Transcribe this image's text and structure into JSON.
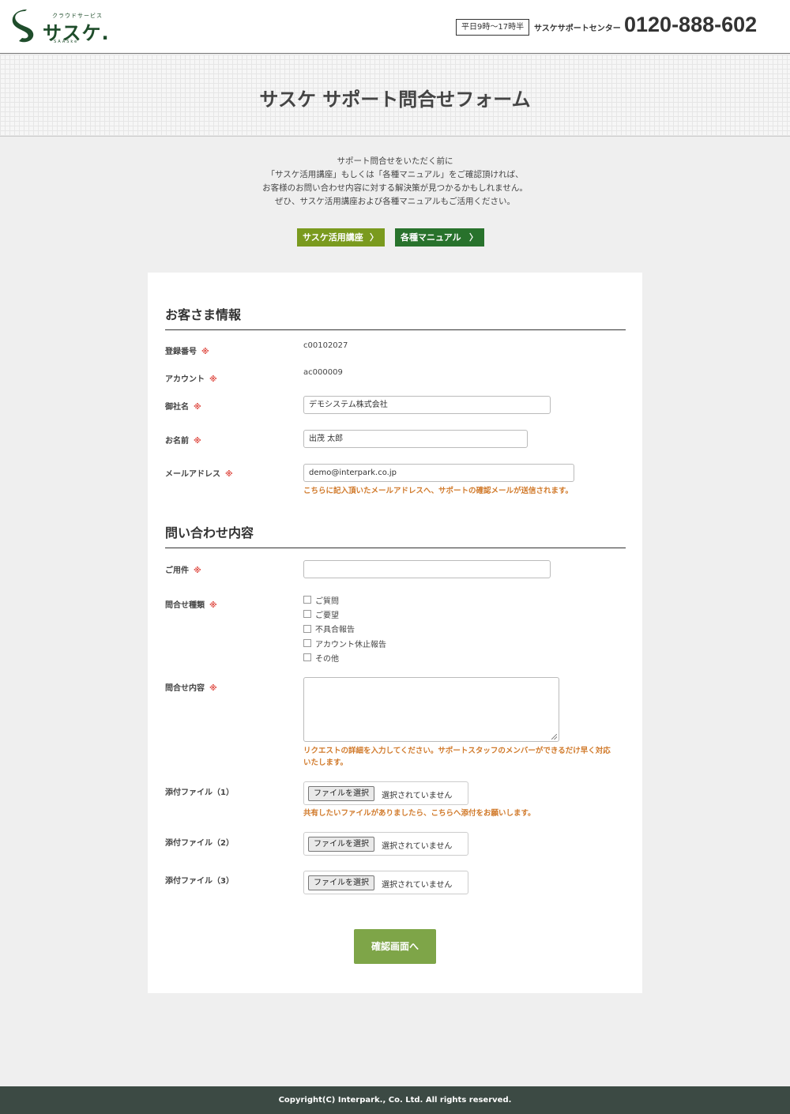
{
  "header": {
    "logo_small": "クラウドサービス",
    "logo_main": "サスケ.",
    "logo_sub": "SAASke",
    "hours": "平日9時〜17時半",
    "center": "サスケサポートセンター",
    "phone": "0120-888-602"
  },
  "banner": {
    "title": "サスケ サポート問合せフォーム"
  },
  "intro": {
    "lines": [
      "サポート問合せをいただく前に",
      "「サスケ活用講座」もしくは「各種マニュアル」をご確認頂ければ、",
      "お客様のお問い合わせ内容に対する解決策が見つかるかもしれません。",
      "ぜひ、サスケ活用講座および各種マニュアルもご活用ください。"
    ],
    "btn_course": "サスケ活用講座",
    "btn_manual": "各種マニュアル",
    "arrow": "〉"
  },
  "customer": {
    "title": "お客さま情報",
    "reg_label": "登録番号",
    "reg_value": "c00102027",
    "account_label": "アカウント",
    "account_value": "ac000009",
    "company_label": "御社名",
    "company_value": "デモシステム株式会社",
    "name_label": "お名前",
    "name_value": "出茂 太郎",
    "email_label": "メールアドレス",
    "email_value": "demo@interpark.co.jp",
    "email_note": "こちらに記入頂いたメールアドレスへ、サポートの確認メールが送信されます。"
  },
  "inquiry": {
    "title": "問い合わせ内容",
    "subject_label": "ご用件",
    "subject_value": "",
    "type_label": "問合せ種類",
    "types": [
      "ご質問",
      "ご要望",
      "不具合報告",
      "アカウント休止報告",
      "その他"
    ],
    "content_label": "問合せ内容",
    "content_note_1": "リクエストの詳細を入力してください。サポートスタッフのメンバーができるだけ早く対応",
    "content_note_2": "いたします。",
    "file1_label": "添付ファイル（1）",
    "file2_label": "添付ファイル（2）",
    "file3_label": "添付ファイル（3）",
    "file_button": "ファイルを選択",
    "file_none": "選択されていません",
    "file_note": "共有したいファイルがありましたら、こちらへ添付をお願いします。",
    "submit": "確認画面へ"
  },
  "required_mark": "※",
  "footer": {
    "copyright": "Copyright(C) Interpark., Co. Ltd. All rights reserved."
  }
}
